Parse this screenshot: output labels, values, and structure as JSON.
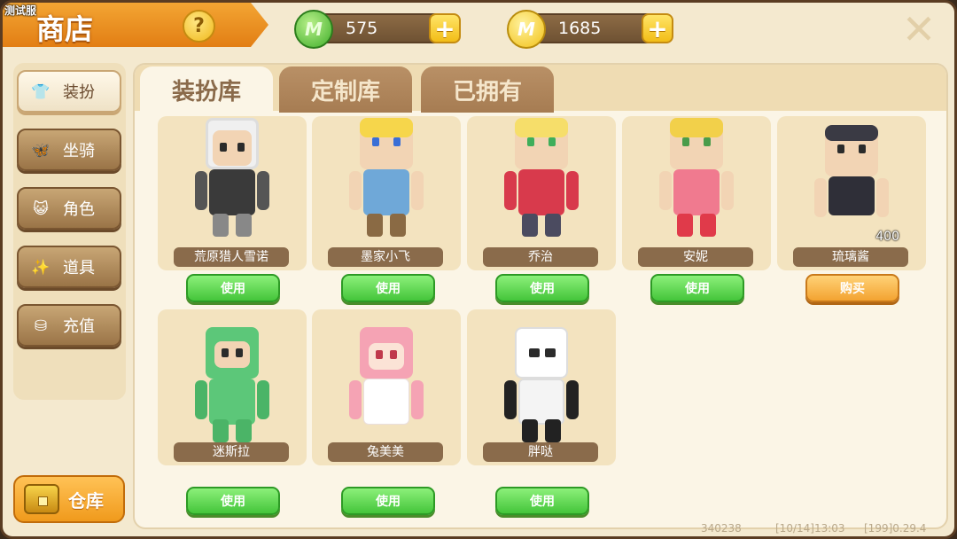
{
  "build_tag": "测试服",
  "header": {
    "title": "商店",
    "help_label": "?",
    "currencies": [
      {
        "name": "green-gems",
        "icon": "M",
        "amount": "575",
        "color": "#44b32c"
      },
      {
        "name": "gold-coins",
        "icon": "M",
        "amount": "1685",
        "color": "#f2c118"
      }
    ],
    "plus_label": "+",
    "close_label": "✕"
  },
  "sidebar": {
    "items": [
      {
        "label": "装扮",
        "icon": "shirt-icon",
        "glyph": "👕"
      },
      {
        "label": "坐骑",
        "icon": "bow-icon",
        "glyph": "🦋"
      },
      {
        "label": "角色",
        "icon": "cat-face-icon",
        "glyph": "😺"
      },
      {
        "label": "道具",
        "icon": "sparkle-icon",
        "glyph": "✨"
      },
      {
        "label": "充值",
        "icon": "coin-stack-icon",
        "glyph": "⛁"
      }
    ],
    "warehouse_label": "仓库"
  },
  "tabs": [
    {
      "label": "装扮库",
      "active": true
    },
    {
      "label": "定制库",
      "active": false
    },
    {
      "label": "已拥有",
      "active": false
    }
  ],
  "items": [
    {
      "name": "荒原猎人雪诺",
      "action": "使用",
      "type": "use"
    },
    {
      "name": "墨家小飞",
      "action": "使用",
      "type": "use"
    },
    {
      "name": "乔治",
      "action": "使用",
      "type": "use"
    },
    {
      "name": "安妮",
      "action": "使用",
      "type": "use"
    },
    {
      "name": "琉璃酱",
      "action": "购买",
      "type": "buy",
      "price": "400"
    },
    {
      "name": "迷斯拉",
      "action": "使用",
      "type": "use"
    },
    {
      "name": "兔美美",
      "action": "使用",
      "type": "use"
    },
    {
      "name": "胖哒",
      "action": "使用",
      "type": "use"
    }
  ],
  "footer": {
    "id": "340238",
    "date": "[10/14]13:03",
    "version": "[199]0.29.4"
  },
  "colors": {
    "accent": "#f09a1c",
    "use_button": "#44c53a",
    "buy_button": "#f3a331",
    "panel_bg": "#fbf5e6"
  }
}
